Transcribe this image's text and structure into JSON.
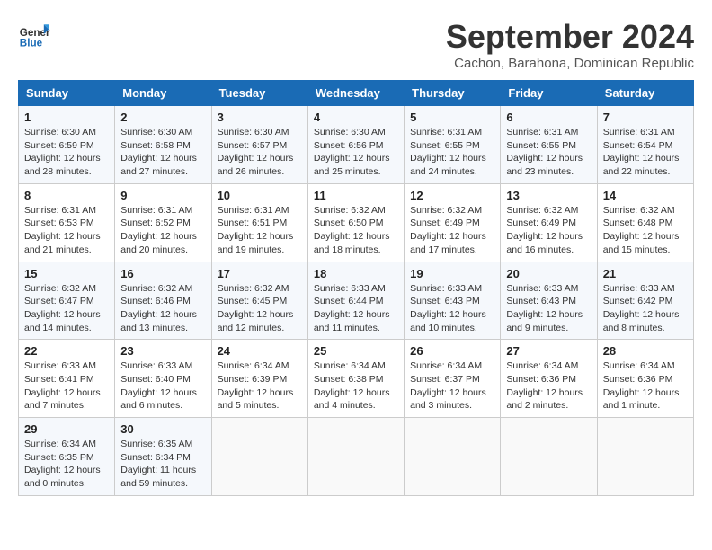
{
  "header": {
    "logo_line1": "General",
    "logo_line2": "Blue",
    "month": "September 2024",
    "location": "Cachon, Barahona, Dominican Republic"
  },
  "weekdays": [
    "Sunday",
    "Monday",
    "Tuesday",
    "Wednesday",
    "Thursday",
    "Friday",
    "Saturday"
  ],
  "weeks": [
    [
      {
        "day": "1",
        "info": "Sunrise: 6:30 AM\nSunset: 6:59 PM\nDaylight: 12 hours\nand 28 minutes."
      },
      {
        "day": "2",
        "info": "Sunrise: 6:30 AM\nSunset: 6:58 PM\nDaylight: 12 hours\nand 27 minutes."
      },
      {
        "day": "3",
        "info": "Sunrise: 6:30 AM\nSunset: 6:57 PM\nDaylight: 12 hours\nand 26 minutes."
      },
      {
        "day": "4",
        "info": "Sunrise: 6:30 AM\nSunset: 6:56 PM\nDaylight: 12 hours\nand 25 minutes."
      },
      {
        "day": "5",
        "info": "Sunrise: 6:31 AM\nSunset: 6:55 PM\nDaylight: 12 hours\nand 24 minutes."
      },
      {
        "day": "6",
        "info": "Sunrise: 6:31 AM\nSunset: 6:55 PM\nDaylight: 12 hours\nand 23 minutes."
      },
      {
        "day": "7",
        "info": "Sunrise: 6:31 AM\nSunset: 6:54 PM\nDaylight: 12 hours\nand 22 minutes."
      }
    ],
    [
      {
        "day": "8",
        "info": "Sunrise: 6:31 AM\nSunset: 6:53 PM\nDaylight: 12 hours\nand 21 minutes."
      },
      {
        "day": "9",
        "info": "Sunrise: 6:31 AM\nSunset: 6:52 PM\nDaylight: 12 hours\nand 20 minutes."
      },
      {
        "day": "10",
        "info": "Sunrise: 6:31 AM\nSunset: 6:51 PM\nDaylight: 12 hours\nand 19 minutes."
      },
      {
        "day": "11",
        "info": "Sunrise: 6:32 AM\nSunset: 6:50 PM\nDaylight: 12 hours\nand 18 minutes."
      },
      {
        "day": "12",
        "info": "Sunrise: 6:32 AM\nSunset: 6:49 PM\nDaylight: 12 hours\nand 17 minutes."
      },
      {
        "day": "13",
        "info": "Sunrise: 6:32 AM\nSunset: 6:49 PM\nDaylight: 12 hours\nand 16 minutes."
      },
      {
        "day": "14",
        "info": "Sunrise: 6:32 AM\nSunset: 6:48 PM\nDaylight: 12 hours\nand 15 minutes."
      }
    ],
    [
      {
        "day": "15",
        "info": "Sunrise: 6:32 AM\nSunset: 6:47 PM\nDaylight: 12 hours\nand 14 minutes."
      },
      {
        "day": "16",
        "info": "Sunrise: 6:32 AM\nSunset: 6:46 PM\nDaylight: 12 hours\nand 13 minutes."
      },
      {
        "day": "17",
        "info": "Sunrise: 6:32 AM\nSunset: 6:45 PM\nDaylight: 12 hours\nand 12 minutes."
      },
      {
        "day": "18",
        "info": "Sunrise: 6:33 AM\nSunset: 6:44 PM\nDaylight: 12 hours\nand 11 minutes."
      },
      {
        "day": "19",
        "info": "Sunrise: 6:33 AM\nSunset: 6:43 PM\nDaylight: 12 hours\nand 10 minutes."
      },
      {
        "day": "20",
        "info": "Sunrise: 6:33 AM\nSunset: 6:43 PM\nDaylight: 12 hours\nand 9 minutes."
      },
      {
        "day": "21",
        "info": "Sunrise: 6:33 AM\nSunset: 6:42 PM\nDaylight: 12 hours\nand 8 minutes."
      }
    ],
    [
      {
        "day": "22",
        "info": "Sunrise: 6:33 AM\nSunset: 6:41 PM\nDaylight: 12 hours\nand 7 minutes."
      },
      {
        "day": "23",
        "info": "Sunrise: 6:33 AM\nSunset: 6:40 PM\nDaylight: 12 hours\nand 6 minutes."
      },
      {
        "day": "24",
        "info": "Sunrise: 6:34 AM\nSunset: 6:39 PM\nDaylight: 12 hours\nand 5 minutes."
      },
      {
        "day": "25",
        "info": "Sunrise: 6:34 AM\nSunset: 6:38 PM\nDaylight: 12 hours\nand 4 minutes."
      },
      {
        "day": "26",
        "info": "Sunrise: 6:34 AM\nSunset: 6:37 PM\nDaylight: 12 hours\nand 3 minutes."
      },
      {
        "day": "27",
        "info": "Sunrise: 6:34 AM\nSunset: 6:36 PM\nDaylight: 12 hours\nand 2 minutes."
      },
      {
        "day": "28",
        "info": "Sunrise: 6:34 AM\nSunset: 6:36 PM\nDaylight: 12 hours\nand 1 minute."
      }
    ],
    [
      {
        "day": "29",
        "info": "Sunrise: 6:34 AM\nSunset: 6:35 PM\nDaylight: 12 hours\nand 0 minutes."
      },
      {
        "day": "30",
        "info": "Sunrise: 6:35 AM\nSunset: 6:34 PM\nDaylight: 11 hours\nand 59 minutes."
      },
      {
        "day": "",
        "info": ""
      },
      {
        "day": "",
        "info": ""
      },
      {
        "day": "",
        "info": ""
      },
      {
        "day": "",
        "info": ""
      },
      {
        "day": "",
        "info": ""
      }
    ]
  ]
}
